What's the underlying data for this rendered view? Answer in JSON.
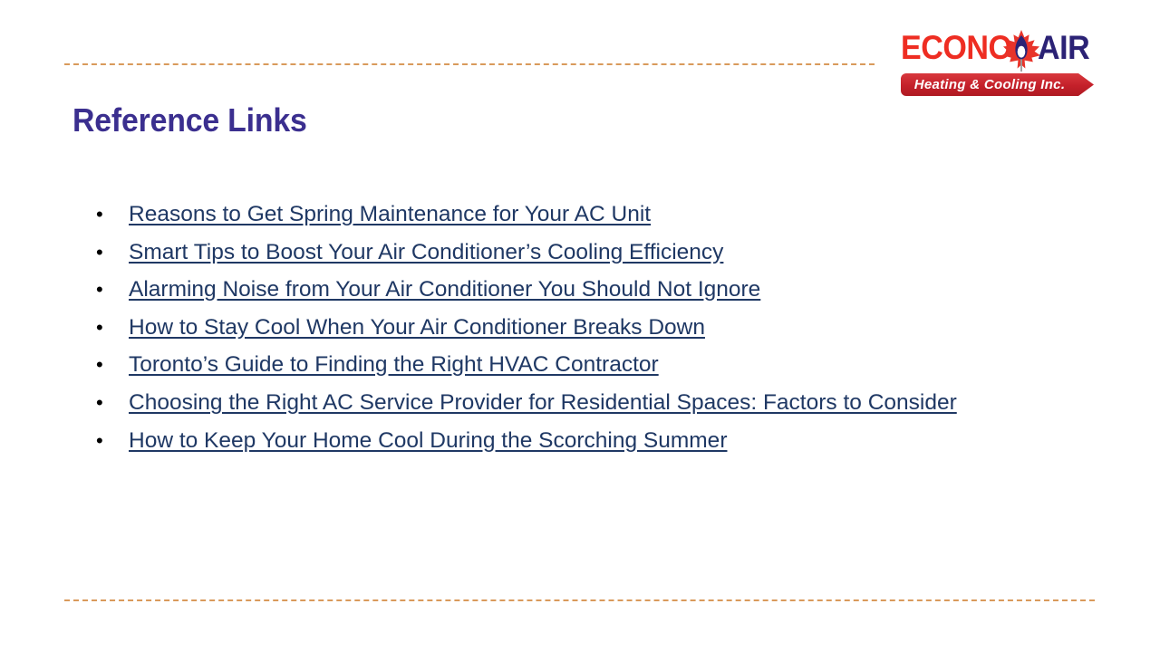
{
  "slide": {
    "title": "Reference Links",
    "background_color": "#FFFFFF",
    "title_color": "#3B2F8F",
    "link_color": "#1F3864",
    "divider_color": "#D99A5B"
  },
  "logo": {
    "word_one": "ECONO",
    "word_two": "AIR",
    "word_one_color": "#EE2D22",
    "word_two_color": "#2B2275",
    "leaf_icon": "maple-leaf-flame-icon",
    "banner_text": "Heating & Cooling Inc.",
    "banner_color": "#C9252B"
  },
  "links": [
    {
      "bullet": "•",
      "label": "Reasons to Get Spring Maintenance for Your AC Unit"
    },
    {
      "bullet": "•",
      "label": "Smart Tips to Boost Your Air Conditioner’s Cooling Efficiency"
    },
    {
      "bullet": "•",
      "label": "Alarming Noise from Your Air Conditioner You Should Not Ignore"
    },
    {
      "bullet": "•",
      "label": "How to Stay Cool When Your Air Conditioner Breaks Down"
    },
    {
      "bullet": "•",
      "label": "Toronto’s Guide to Finding the Right HVAC Contractor"
    },
    {
      "bullet": "•",
      "label": "Choosing the Right AC Service Provider for Residential Spaces: Factors to Consider"
    },
    {
      "bullet": "•",
      "label": "How to Keep Your Home Cool During the Scorching Summer"
    }
  ]
}
